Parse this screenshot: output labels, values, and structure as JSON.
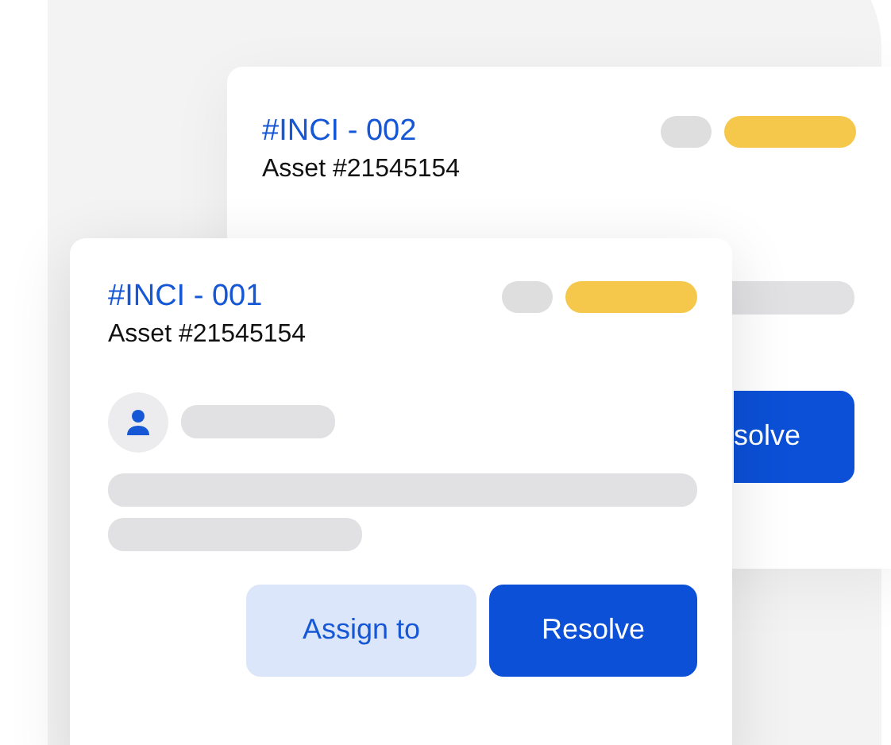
{
  "cards": [
    {
      "title": "#INCI - 002",
      "asset": "Asset #21545154",
      "tags": [
        {
          "color": "#dedede"
        },
        {
          "color": "#f5c84c"
        }
      ],
      "buttons": [
        {
          "label": "solve",
          "kind": "primary"
        }
      ]
    },
    {
      "title": "#INCI - 001",
      "asset": "Asset #21545154",
      "tags": [
        {
          "color": "#dedede"
        },
        {
          "color": "#f5c84c"
        }
      ],
      "buttons": [
        {
          "label": "Assign to",
          "kind": "secondary"
        },
        {
          "label": "Resolve",
          "kind": "primary"
        }
      ]
    }
  ]
}
